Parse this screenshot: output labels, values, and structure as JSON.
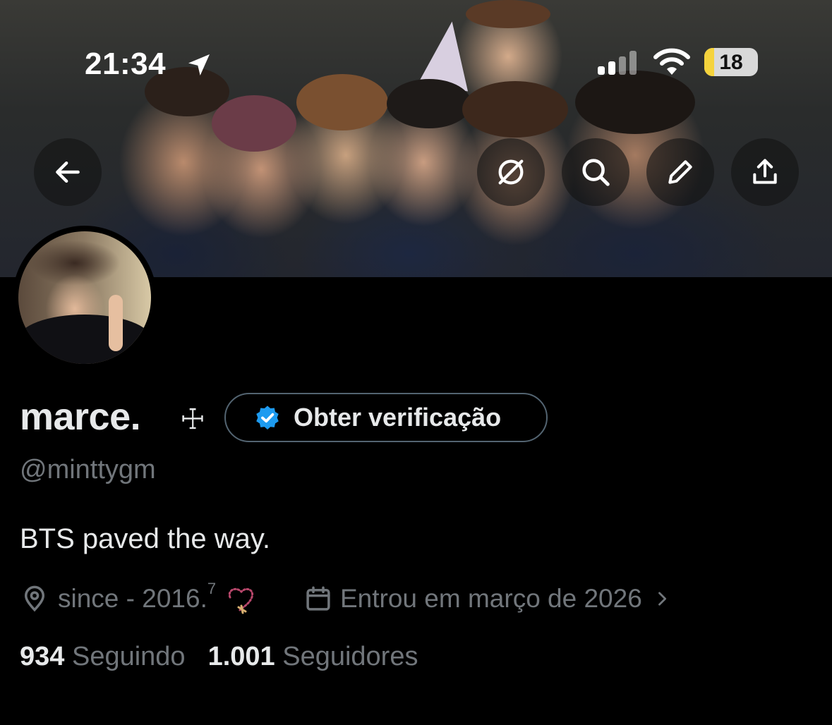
{
  "status_bar": {
    "time": "21:34",
    "battery": "18",
    "battery_level": 0.18
  },
  "header": {
    "back_icon": "arrow-left-icon",
    "actions": [
      "hide-icon",
      "search-icon",
      "edit-icon",
      "share-icon"
    ]
  },
  "profile": {
    "display_name": "marce.",
    "name_symbol": "☩",
    "verify_button_label": "Obter verificação",
    "handle": "@minttygm",
    "bio": "BTS paved the way.",
    "location": "since - 2016.",
    "location_sup": "7",
    "joined": "Entrou em março de 2026",
    "following_count": "934",
    "following_label": "Seguindo",
    "followers_count": "1.001",
    "followers_label": "Seguidores"
  },
  "colors": {
    "background": "#000000",
    "primary_text": "#e7e9ea",
    "secondary_text": "#71767b",
    "verify_blue": "#1d9bf0",
    "battery_yellow": "#f5d33c"
  }
}
